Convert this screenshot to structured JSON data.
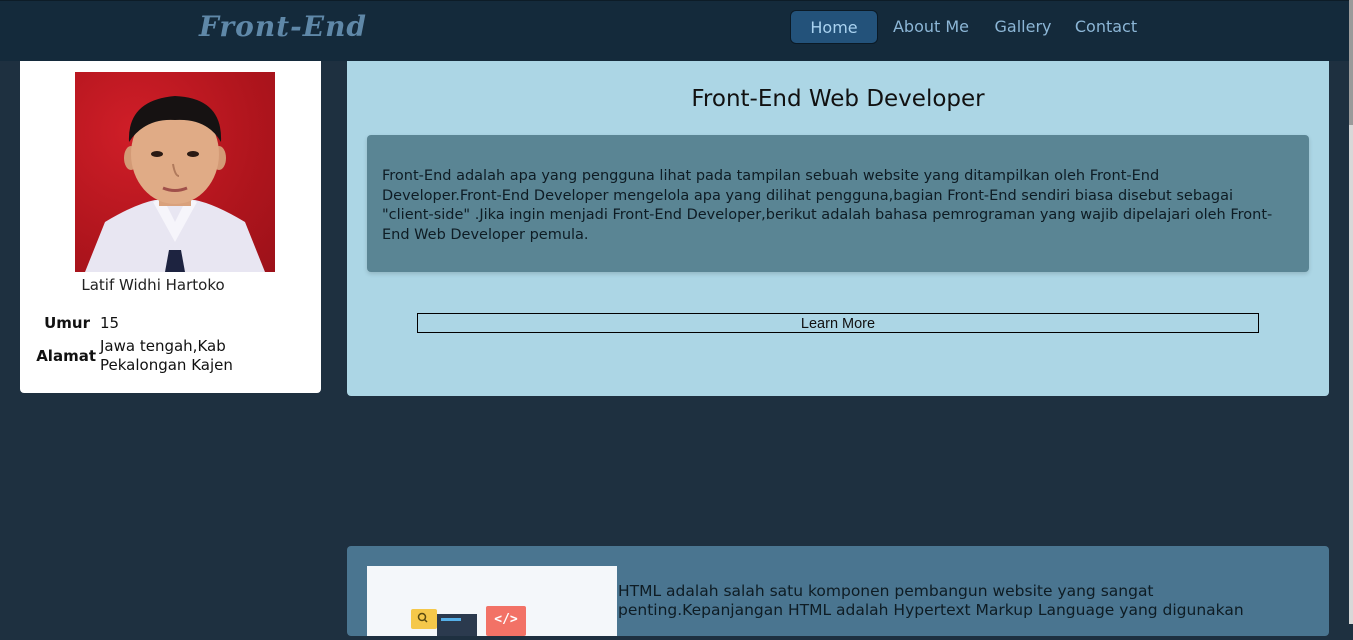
{
  "nav": {
    "brand": "Front-End",
    "items": [
      {
        "label": "Home",
        "active": true
      },
      {
        "label": "About Me",
        "active": false
      },
      {
        "label": "Gallery",
        "active": false
      },
      {
        "label": "Contact",
        "active": false
      }
    ]
  },
  "profile": {
    "name": "Latif Widhi Hartoko",
    "age_label": "Umur",
    "age_value": "15",
    "address_label": "Alamat",
    "address_line1": "Jawa tengah,Kab",
    "address_line2": "Pekalongan Kajen"
  },
  "hero": {
    "title": "Front-End Web Developer",
    "description": "Front-End adalah apa yang pengguna lihat pada tampilan sebuah website yang ditampilkan oleh Front-End Developer.Front-End Developer mengelola apa yang dilihat pengguna,bagian Front-End sendiri biasa disebut sebagai \"client-side\" .Jika ingin menjadi Front-End Developer,berikut adalah bahasa pemrograman yang wajib dipelajari oleh Front-End Web Developer pemula.",
    "button_label": "Learn More"
  },
  "html_section": {
    "text": "HTML adalah salah satu komponen pembangun website yang sangat penting.Kepanjangan HTML adalah Hypertext Markup Language yang digunakan",
    "code_tag": "</>"
  },
  "colors": {
    "navbar": "#142a3b",
    "page_bg": "#1e3040",
    "hero_bg": "#acd6e5",
    "hero_box": "#5a8594",
    "html_section": "#4a7590",
    "nav_active": "#23527a"
  }
}
